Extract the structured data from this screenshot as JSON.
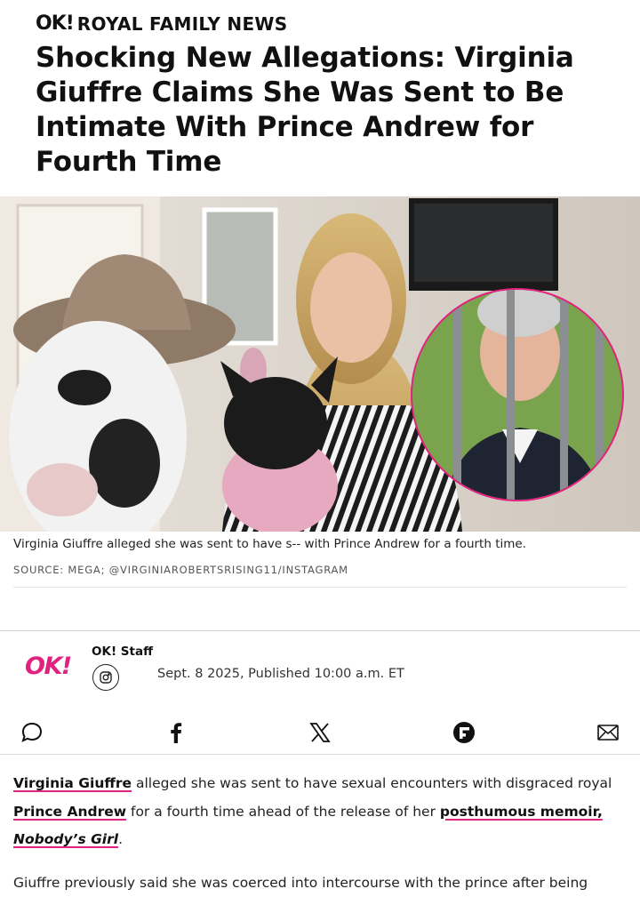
{
  "header": {
    "logo": "OK!",
    "section": "ROYAL FAMILY NEWS"
  },
  "article": {
    "headline": "Shocking New Allegations: Virginia Giuffre Claims She Was Sent to Be Intimate With Prince Andrew for Fourth Time",
    "image_caption": "Virginia Giuffre alleged she was sent to have s-- with Prince Andrew for a fourth time.",
    "image_source": "SOURCE: MEGA; @VIRGINIAROBERTSRISING11/INSTAGRAM",
    "author": {
      "logo": "OK!",
      "name": "OK! Staff",
      "social_icon": "instagram-icon"
    },
    "published": "Sept. 8 2025, Published 10:00 a.m. ET",
    "paragraph1": {
      "link1": "Virginia Giuffre",
      "text1": " alleged she was sent to have sexual encounters with disgraced royal ",
      "link2": "Prince Andrew",
      "text2": " for a fourth time ahead of the release of her ",
      "link3": "posthumous memoir,",
      "text3": " ",
      "link4": "Nobody’s Girl",
      "text4": "."
    },
    "paragraph2": "Giuffre previously said she was coerced into intercourse with the prince after being"
  },
  "share": {
    "icons": [
      "comment-icon",
      "facebook-icon",
      "x-icon",
      "flipboard-icon",
      "email-icon"
    ]
  },
  "colors": {
    "accent": "#e2227f",
    "text": "#111111"
  }
}
